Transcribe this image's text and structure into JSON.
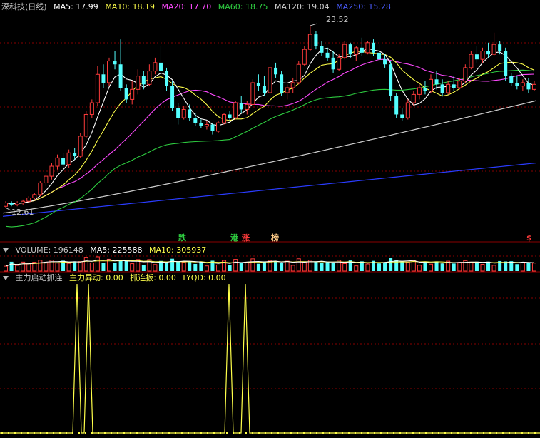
{
  "colors": {
    "up": "#ff3b3b",
    "down": "#54ffff",
    "ma5": "#ffffff",
    "ma10": "#ffff4a",
    "ma20": "#ff4aff",
    "ma60": "#2ecc40",
    "ma120": "#d0d0d0",
    "ma250": "#2a3cff",
    "grid": "#8a0000",
    "volma5": "#ffffff",
    "volma10": "#ffff4a",
    "signal": "#ffff4a"
  },
  "price_panel": {
    "title": "深科技(日线)",
    "ma5_label": "MA5: 17.99",
    "ma10_label": "MA10: 18.19",
    "ma20_label": "MA20: 17.70",
    "ma60_label": "MA60: 18.75",
    "ma120_label": "MA120: 19.04",
    "ma250_label": "MA250: 15.28",
    "high_label": "23.52",
    "low_label": "12.61",
    "events": [
      {
        "label": "跌",
        "color": "#2ecc40"
      },
      {
        "label": "港",
        "color": "#2ecc40"
      },
      {
        "label": "涨",
        "color": "#ff3b3b"
      },
      {
        "label": "榜",
        "color": "#ffcc88"
      },
      {
        "label": "$",
        "color": "#ff3b3b"
      }
    ]
  },
  "volume_panel": {
    "volume_label": "VOLUME: 196148",
    "ma5_label": "MA5: 225588",
    "ma10_label": "MA10: 305937"
  },
  "indicator_panel": {
    "name": "主力启动抓连",
    "signal1_label": "主力异动: 0.00",
    "signal2_label": "抓连扳: 0.00",
    "signal3_label": "LYQD: 0.00"
  },
  "chart_data": {
    "type": "candlestick",
    "title": "深科技(日线)",
    "price_range": [
      12.61,
      23.52
    ],
    "candles": [
      {
        "o": 12.7,
        "h": 13.0,
        "l": 12.61,
        "c": 12.9
      },
      {
        "o": 12.9,
        "h": 13.0,
        "l": 12.7,
        "c": 12.8
      },
      {
        "o": 12.8,
        "h": 13.0,
        "l": 12.7,
        "c": 12.9
      },
      {
        "o": 12.9,
        "h": 13.1,
        "l": 12.8,
        "c": 13.0
      },
      {
        "o": 13.0,
        "h": 13.3,
        "l": 12.9,
        "c": 13.2
      },
      {
        "o": 13.2,
        "h": 13.5,
        "l": 13.1,
        "c": 13.4
      },
      {
        "o": 13.4,
        "h": 14.2,
        "l": 13.3,
        "c": 14.1
      },
      {
        "o": 14.1,
        "h": 14.6,
        "l": 13.9,
        "c": 14.5
      },
      {
        "o": 14.5,
        "h": 15.3,
        "l": 14.3,
        "c": 15.1
      },
      {
        "o": 15.1,
        "h": 15.8,
        "l": 14.9,
        "c": 15.6
      },
      {
        "o": 15.6,
        "h": 15.9,
        "l": 15.0,
        "c": 15.2
      },
      {
        "o": 15.2,
        "h": 16.1,
        "l": 15.0,
        "c": 15.9
      },
      {
        "o": 15.9,
        "h": 16.2,
        "l": 15.5,
        "c": 15.7
      },
      {
        "o": 15.7,
        "h": 17.1,
        "l": 15.6,
        "c": 16.9
      },
      {
        "o": 16.9,
        "h": 18.4,
        "l": 16.8,
        "c": 18.2
      },
      {
        "o": 18.2,
        "h": 19.1,
        "l": 18.0,
        "c": 18.9
      },
      {
        "o": 18.9,
        "h": 21.1,
        "l": 18.7,
        "c": 20.6
      },
      {
        "o": 20.6,
        "h": 21.2,
        "l": 19.8,
        "c": 20.1
      },
      {
        "o": 20.1,
        "h": 21.6,
        "l": 19.9,
        "c": 21.4
      },
      {
        "o": 21.4,
        "h": 22.0,
        "l": 20.9,
        "c": 21.2
      },
      {
        "o": 21.2,
        "h": 22.7,
        "l": 19.6,
        "c": 19.8
      },
      {
        "o": 19.8,
        "h": 20.0,
        "l": 18.9,
        "c": 19.1
      },
      {
        "o": 19.1,
        "h": 20.2,
        "l": 18.8,
        "c": 19.7
      },
      {
        "o": 19.7,
        "h": 20.9,
        "l": 19.4,
        "c": 20.5
      },
      {
        "o": 20.5,
        "h": 20.8,
        "l": 19.7,
        "c": 20.0
      },
      {
        "o": 20.0,
        "h": 21.2,
        "l": 19.9,
        "c": 20.8
      },
      {
        "o": 20.8,
        "h": 21.6,
        "l": 20.6,
        "c": 21.3
      },
      {
        "o": 21.3,
        "h": 22.3,
        "l": 20.5,
        "c": 20.8
      },
      {
        "o": 20.8,
        "h": 21.0,
        "l": 19.6,
        "c": 19.9
      },
      {
        "o": 19.9,
        "h": 20.2,
        "l": 18.4,
        "c": 18.6
      },
      {
        "o": 18.6,
        "h": 18.9,
        "l": 17.6,
        "c": 18.0
      },
      {
        "o": 18.0,
        "h": 18.7,
        "l": 17.9,
        "c": 18.5
      },
      {
        "o": 18.5,
        "h": 18.8,
        "l": 17.8,
        "c": 18.0
      },
      {
        "o": 18.0,
        "h": 18.3,
        "l": 17.5,
        "c": 17.7
      },
      {
        "o": 17.7,
        "h": 17.9,
        "l": 17.4,
        "c": 17.5
      },
      {
        "o": 17.5,
        "h": 17.8,
        "l": 17.3,
        "c": 17.6
      },
      {
        "o": 17.6,
        "h": 17.7,
        "l": 17.0,
        "c": 17.2
      },
      {
        "o": 17.2,
        "h": 17.8,
        "l": 17.1,
        "c": 17.7
      },
      {
        "o": 17.7,
        "h": 18.3,
        "l": 17.6,
        "c": 18.2
      },
      {
        "o": 18.2,
        "h": 18.4,
        "l": 17.8,
        "c": 18.0
      },
      {
        "o": 18.0,
        "h": 19.0,
        "l": 17.9,
        "c": 18.9
      },
      {
        "o": 18.9,
        "h": 19.3,
        "l": 18.3,
        "c": 18.5
      },
      {
        "o": 18.5,
        "h": 19.0,
        "l": 18.2,
        "c": 18.8
      },
      {
        "o": 18.8,
        "h": 20.3,
        "l": 18.7,
        "c": 20.1
      },
      {
        "o": 20.1,
        "h": 20.6,
        "l": 19.6,
        "c": 19.9
      },
      {
        "o": 19.9,
        "h": 20.5,
        "l": 19.3,
        "c": 19.5
      },
      {
        "o": 19.5,
        "h": 21.2,
        "l": 19.3,
        "c": 21.0
      },
      {
        "o": 21.0,
        "h": 21.3,
        "l": 20.4,
        "c": 20.6
      },
      {
        "o": 20.6,
        "h": 20.8,
        "l": 19.3,
        "c": 19.5
      },
      {
        "o": 19.5,
        "h": 20.0,
        "l": 19.1,
        "c": 19.8
      },
      {
        "o": 19.8,
        "h": 20.4,
        "l": 19.5,
        "c": 20.1
      },
      {
        "o": 20.1,
        "h": 21.4,
        "l": 20.0,
        "c": 21.2
      },
      {
        "o": 21.2,
        "h": 22.3,
        "l": 21.1,
        "c": 22.1
      },
      {
        "o": 22.1,
        "h": 23.52,
        "l": 22.0,
        "c": 23.0
      },
      {
        "o": 23.0,
        "h": 23.2,
        "l": 22.1,
        "c": 22.3
      },
      {
        "o": 22.3,
        "h": 22.6,
        "l": 21.7,
        "c": 21.9
      },
      {
        "o": 21.9,
        "h": 22.2,
        "l": 21.4,
        "c": 21.6
      },
      {
        "o": 21.6,
        "h": 22.0,
        "l": 20.7,
        "c": 20.9
      },
      {
        "o": 20.9,
        "h": 21.8,
        "l": 20.8,
        "c": 21.6
      },
      {
        "o": 21.6,
        "h": 22.6,
        "l": 21.5,
        "c": 22.4
      },
      {
        "o": 22.4,
        "h": 22.5,
        "l": 21.6,
        "c": 21.8
      },
      {
        "o": 21.8,
        "h": 22.3,
        "l": 21.4,
        "c": 22.2
      },
      {
        "o": 22.2,
        "h": 22.8,
        "l": 21.7,
        "c": 21.9
      },
      {
        "o": 21.9,
        "h": 22.6,
        "l": 21.8,
        "c": 22.5
      },
      {
        "o": 22.5,
        "h": 22.7,
        "l": 21.7,
        "c": 21.9
      },
      {
        "o": 21.9,
        "h": 22.4,
        "l": 21.3,
        "c": 21.5
      },
      {
        "o": 21.5,
        "h": 21.8,
        "l": 21.0,
        "c": 21.2
      },
      {
        "o": 21.2,
        "h": 21.4,
        "l": 19.0,
        "c": 19.3
      },
      {
        "o": 19.3,
        "h": 19.5,
        "l": 18.0,
        "c": 18.2
      },
      {
        "o": 18.2,
        "h": 18.6,
        "l": 17.8,
        "c": 18.0
      },
      {
        "o": 18.0,
        "h": 19.1,
        "l": 17.9,
        "c": 18.9
      },
      {
        "o": 18.9,
        "h": 19.6,
        "l": 18.7,
        "c": 19.4
      },
      {
        "o": 19.4,
        "h": 20.0,
        "l": 19.1,
        "c": 19.8
      },
      {
        "o": 19.8,
        "h": 20.2,
        "l": 19.4,
        "c": 19.6
      },
      {
        "o": 19.6,
        "h": 20.6,
        "l": 19.5,
        "c": 20.3
      },
      {
        "o": 20.3,
        "h": 20.8,
        "l": 19.7,
        "c": 20.0
      },
      {
        "o": 20.0,
        "h": 20.3,
        "l": 19.3,
        "c": 19.5
      },
      {
        "o": 19.5,
        "h": 20.2,
        "l": 19.4,
        "c": 20.0
      },
      {
        "o": 20.0,
        "h": 20.5,
        "l": 19.6,
        "c": 19.8
      },
      {
        "o": 19.8,
        "h": 20.4,
        "l": 19.7,
        "c": 20.2
      },
      {
        "o": 20.2,
        "h": 21.2,
        "l": 20.1,
        "c": 21.0
      },
      {
        "o": 21.0,
        "h": 22.0,
        "l": 20.9,
        "c": 21.8
      },
      {
        "o": 21.8,
        "h": 22.3,
        "l": 21.3,
        "c": 21.5
      },
      {
        "o": 21.5,
        "h": 22.2,
        "l": 21.3,
        "c": 22.0
      },
      {
        "o": 22.0,
        "h": 22.5,
        "l": 21.6,
        "c": 21.8
      },
      {
        "o": 21.8,
        "h": 23.1,
        "l": 21.7,
        "c": 22.4
      },
      {
        "o": 22.4,
        "h": 22.6,
        "l": 21.8,
        "c": 22.0
      },
      {
        "o": 22.0,
        "h": 22.2,
        "l": 20.2,
        "c": 20.5
      },
      {
        "o": 20.5,
        "h": 20.7,
        "l": 19.9,
        "c": 20.1
      },
      {
        "o": 20.1,
        "h": 20.5,
        "l": 19.7,
        "c": 19.9
      },
      {
        "o": 19.9,
        "h": 20.3,
        "l": 19.6,
        "c": 20.1
      },
      {
        "o": 20.1,
        "h": 20.4,
        "l": 19.5,
        "c": 19.7
      },
      {
        "o": 19.7,
        "h": 20.2,
        "l": 19.6,
        "c": 20.0
      }
    ],
    "ma": [
      {
        "name": "MA5",
        "last": 17.99
      },
      {
        "name": "MA10",
        "last": 18.19
      },
      {
        "name": "MA20",
        "last": 17.7
      },
      {
        "name": "MA60",
        "last": 18.75
      },
      {
        "name": "MA120",
        "last": 19.04
      },
      {
        "name": "MA250",
        "last": 15.28
      }
    ],
    "volume_last": 196148,
    "signal_spike_indices": [
      17,
      19,
      55,
      59
    ]
  }
}
